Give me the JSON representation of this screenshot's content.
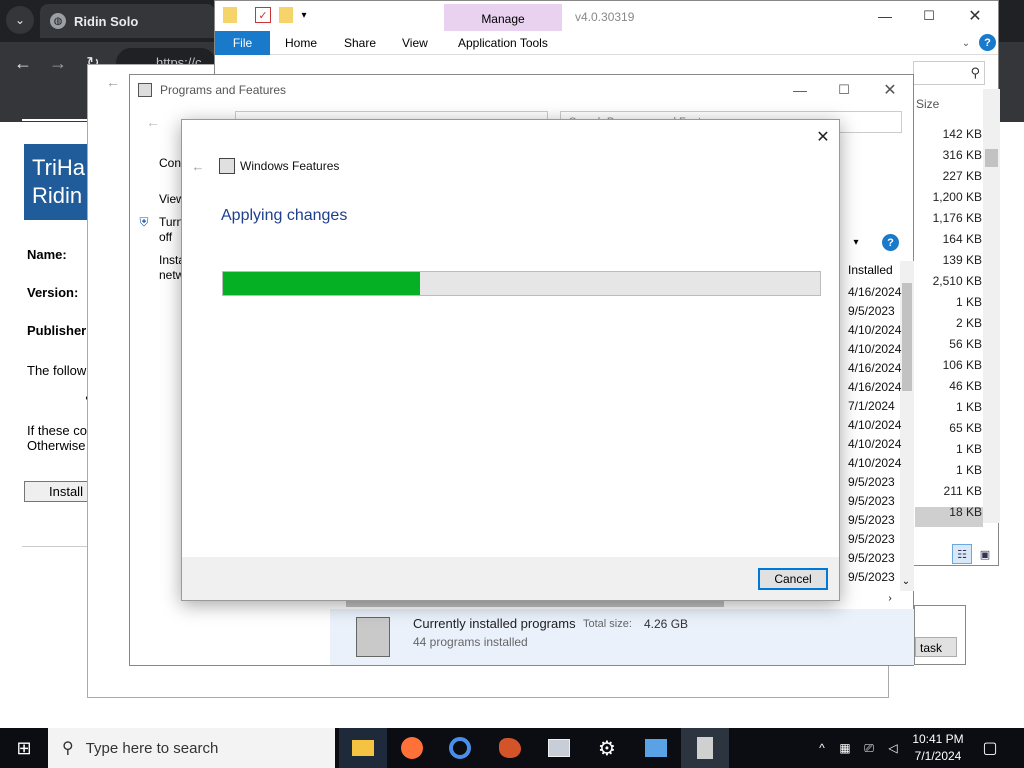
{
  "browser": {
    "tab_title": "Ridin Solo",
    "url": "https://c",
    "page_title": "TriHa\nRidin",
    "labels": {
      "name": "Name:",
      "version": "Version:",
      "publisher": "Publisher",
      "follow": "The follow",
      "if_these": "If these co",
      "otherwise": "Otherwise"
    },
    "install_button": "Install"
  },
  "explorer": {
    "manage": "Manage",
    "version": "v4.0.30319",
    "tabs": [
      "File",
      "Home",
      "Share",
      "View",
      "Application Tools"
    ],
    "size_header": "Size",
    "sizes": [
      "142 KB",
      "316 KB",
      "227 KB",
      "1,200 KB",
      "1,176 KB",
      "164 KB",
      "139 KB",
      "2,510 KB",
      "1 KB",
      "2 KB",
      "56 KB",
      "106 KB",
      "46 KB",
      "1 KB",
      "65 KB",
      "1 KB",
      "1 KB",
      "211 KB",
      "18 KB"
    ],
    "task_button": "task"
  },
  "control_panel": {
    "title": "Programs and Features",
    "search_placeholder": "Search Programs and Features",
    "sidebar": [
      "Con",
      "View",
      "Turn",
      "off",
      "Insta",
      "netw"
    ],
    "installed_header": "Installed",
    "dates": [
      "4/16/2024",
      "9/5/2023",
      "4/10/2024",
      "4/10/2024",
      "4/16/2024",
      "4/16/2024",
      "7/1/2024",
      "4/10/2024",
      "4/10/2024",
      "4/10/2024",
      "9/5/2023",
      "9/5/2023",
      "9/5/2023",
      "9/5/2023",
      "9/5/2023",
      "9/5/2023"
    ],
    "summary": {
      "title": "Currently installed programs",
      "total_label": "Total size:",
      "total_value": "4.26 GB",
      "count": "44 programs installed"
    }
  },
  "dialog": {
    "title": "Windows Features",
    "heading": "Applying changes",
    "progress": 0.33,
    "cancel": "Cancel"
  },
  "taskbar": {
    "search_placeholder": "Type here to search",
    "time": "10:41 PM",
    "date": "7/1/2024"
  },
  "colors": {
    "accent": "#0078d7",
    "progress": "#06b025",
    "heading": "#1e3f8f"
  }
}
